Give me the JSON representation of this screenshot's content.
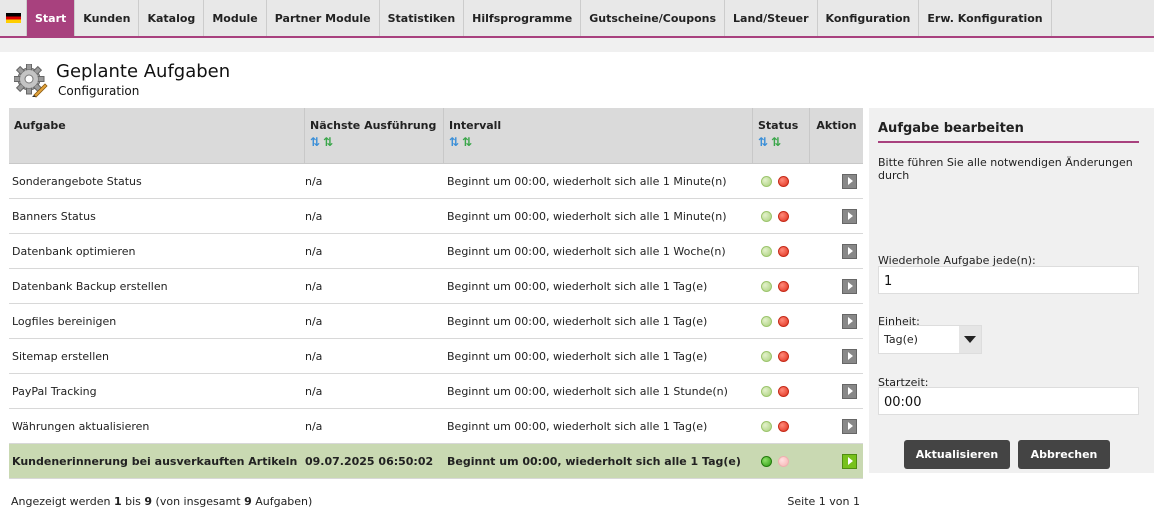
{
  "nav": {
    "items": [
      {
        "label": "Start",
        "active": true
      },
      {
        "label": "Kunden"
      },
      {
        "label": "Katalog"
      },
      {
        "label": "Module"
      },
      {
        "label": "Partner Module"
      },
      {
        "label": "Statistiken"
      },
      {
        "label": "Hilfsprogramme"
      },
      {
        "label": "Gutscheine/Coupons"
      },
      {
        "label": "Land/Steuer"
      },
      {
        "label": "Konfiguration"
      },
      {
        "label": "Erw. Konfiguration"
      }
    ],
    "flag_icon": "flag-de-icon"
  },
  "page": {
    "title": "Geplante Aufgaben",
    "subtitle": "Configuration"
  },
  "table": {
    "headers": {
      "task": "Aufgabe",
      "next_run": "Nächste Ausführung",
      "interval": "Intervall",
      "status": "Status",
      "action": "Aktion"
    },
    "rows": [
      {
        "task": "Sonderangebote Status",
        "next": "n/a",
        "interval": "Beginnt um 00:00, wiederholt sich alle 1 Minute(n)"
      },
      {
        "task": "Banners Status",
        "next": "n/a",
        "interval": "Beginnt um 00:00, wiederholt sich alle 1 Minute(n)"
      },
      {
        "task": "Datenbank optimieren",
        "next": "n/a",
        "interval": "Beginnt um 00:00, wiederholt sich alle 1 Woche(n)"
      },
      {
        "task": "Datenbank Backup erstellen",
        "next": "n/a",
        "interval": "Beginnt um 00:00, wiederholt sich alle 1 Tag(e)"
      },
      {
        "task": "Logfiles bereinigen",
        "next": "n/a",
        "interval": "Beginnt um 00:00, wiederholt sich alle 1 Tag(e)"
      },
      {
        "task": "Sitemap erstellen",
        "next": "n/a",
        "interval": "Beginnt um 00:00, wiederholt sich alle 1 Tag(e)"
      },
      {
        "task": "PayPal Tracking",
        "next": "n/a",
        "interval": "Beginnt um 00:00, wiederholt sich alle 1 Stunde(n)"
      },
      {
        "task": "Währungen aktualisieren",
        "next": "n/a",
        "interval": "Beginnt um 00:00, wiederholt sich alle 1 Tag(e)"
      },
      {
        "task": "Kundenerinnerung bei ausverkauften Artikeln",
        "next": "09.07.2025 06:50:02",
        "interval": "Beginnt um 00:00, wiederholt sich alle 1 Tag(e)",
        "selected": true
      }
    ],
    "footer": {
      "shown_prefix": "Angezeigt werden",
      "from": "1",
      "to_word": "bis",
      "to": "9",
      "total_prefix": "(von insgesamt",
      "total": "9",
      "total_suffix": "Aufgaben)",
      "pages": "Seite 1 von 1"
    }
  },
  "edit": {
    "title": "Aufgabe bearbeiten",
    "description": "Bitte führen Sie alle notwendigen Änderungen durch",
    "repeat_label": "Wiederhole Aufgabe jede(n):",
    "repeat_value": "1",
    "unit_label": "Einheit:",
    "unit_value": "Tag(e)",
    "start_label": "Startzeit:",
    "start_value": "00:00",
    "update_button": "Aktualisieren",
    "cancel_button": "Abbrechen"
  },
  "colors": {
    "accent": "#a8417e",
    "selected_row": "#c9d9b2",
    "button": "#444444"
  }
}
